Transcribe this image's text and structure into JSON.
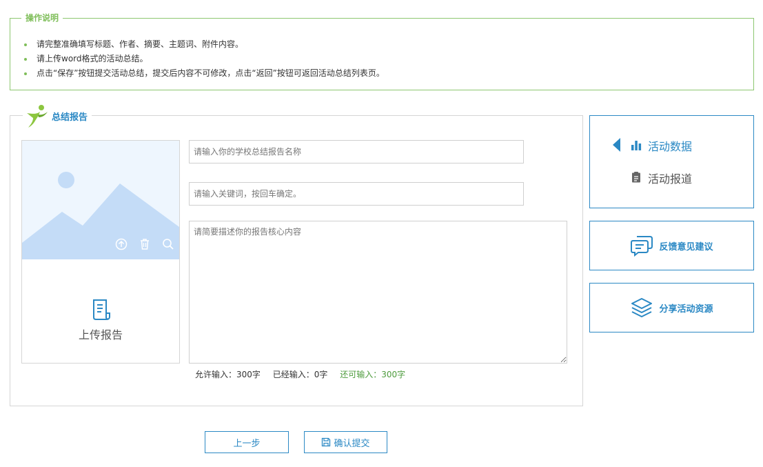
{
  "instructions": {
    "title": "操作说明",
    "items": [
      "请完整准确填写标题、作者、摘要、主题词、附件内容。",
      "请上传word格式的活动总结。",
      "点击“保存”按钮提交活动总结，提交后内容不可修改，点击“返回”按钮可返回活动总结列表页。"
    ]
  },
  "report": {
    "title": "总结报告",
    "upload_label": "上传报告",
    "name_placeholder": "请输入你的学校总结报告名称",
    "keywords_placeholder": "请输入关键词，按回车确定。",
    "summary_placeholder": "请简要描述你的报告核心内容",
    "counter": {
      "allowed": "允许输入：300字",
      "entered": "已经输入：0字",
      "remaining": "还可输入：300字"
    }
  },
  "side_nav": {
    "items": [
      {
        "label": "活动数据",
        "icon": "bar-chart-icon",
        "active": true
      },
      {
        "label": "活动报道",
        "icon": "clipboard-icon",
        "active": false
      }
    ]
  },
  "side_actions": {
    "feedback": {
      "label": "反馈意见建议",
      "icon": "chat-bubble-icon"
    },
    "share": {
      "label": "分享活动资源",
      "icon": "layers-icon"
    }
  },
  "buttons": {
    "prev": "上一步",
    "submit": "确认提交"
  },
  "colors": {
    "accent": "#2a88c4",
    "green": "#7fbe5a",
    "remaining": "#4d9b3c"
  }
}
